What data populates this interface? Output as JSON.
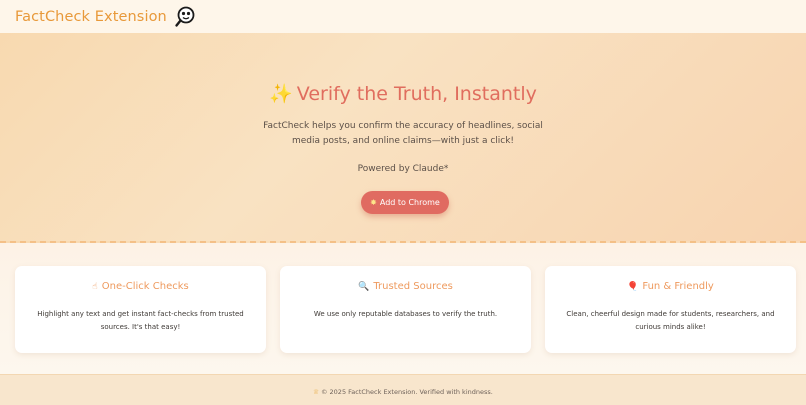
{
  "header": {
    "brand": "FactCheck Extension",
    "logo_icon": "magnifier-face-icon"
  },
  "hero": {
    "title_icon": "sparkles-icon",
    "title_icon_glyph": "✨",
    "title": "Verify the Truth, Instantly",
    "description_line1": "FactCheck helps you confirm the accuracy of headlines, social",
    "description_line2": "media posts, and online claims—with just a click!",
    "powered_by": "Powered by Claude*",
    "cta_icon_glyph": "✸",
    "cta_label": "Add to Chrome"
  },
  "features": [
    {
      "icon": "pointer-hand-icon",
      "icon_glyph": "☝",
      "title": "One-Click Checks",
      "description": "Highlight any text and get instant fact-checks from trusted sources. It's that easy!"
    },
    {
      "icon": "magnifying-glass-icon",
      "icon_glyph": "🔍",
      "title": "Trusted Sources",
      "description": "We use only reputable databases to verify the truth."
    },
    {
      "icon": "balloon-icon",
      "icon_glyph": "🎈",
      "title": "Fun & Friendly",
      "description": "Clean, cheerful design made for students, researchers, and curious minds alike!"
    }
  ],
  "footer": {
    "icon": "crown-icon",
    "icon_glyph": "♕",
    "text": "© 2025 FactCheck Extension. Verified with kindness."
  },
  "colors": {
    "brand": "#e8993a",
    "accent": "#e06b61",
    "card_title": "#ee9a5e",
    "hero_bg": "#f8d9b0"
  }
}
